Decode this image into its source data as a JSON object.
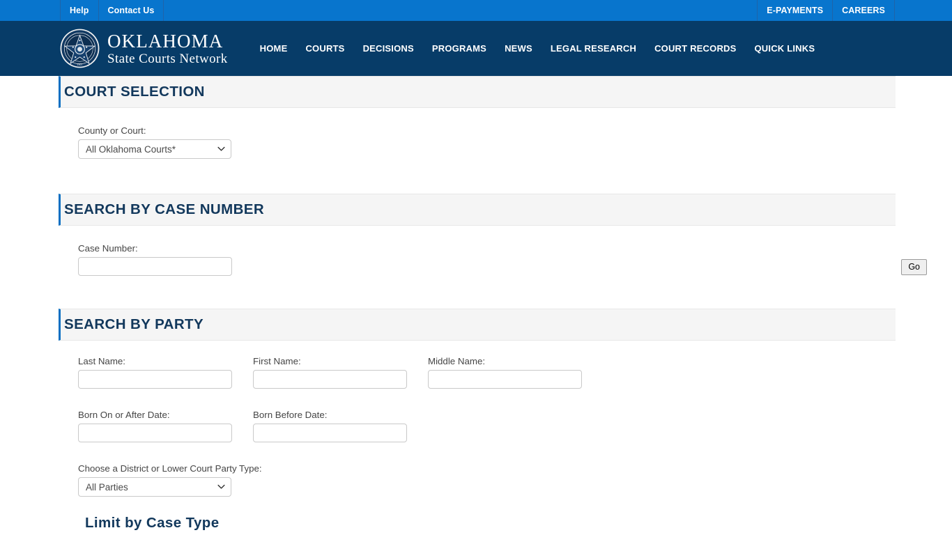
{
  "utility_bar": {
    "left_links": [
      {
        "label": "Help",
        "name": "help"
      },
      {
        "label": "Contact Us",
        "name": "contact-us"
      }
    ],
    "right_links": [
      {
        "label": "E-PAYMENTS",
        "name": "e-payments"
      },
      {
        "label": "CAREERS",
        "name": "careers"
      }
    ]
  },
  "brand": {
    "seal_icon": "oklahoma-state-seal-icon",
    "title": "OKLAHOMA",
    "subtitle": "State Courts Network"
  },
  "nav": {
    "items": [
      {
        "label": "HOME",
        "name": "home"
      },
      {
        "label": "COURTS",
        "name": "courts"
      },
      {
        "label": "DECISIONS",
        "name": "decisions"
      },
      {
        "label": "PROGRAMS",
        "name": "programs"
      },
      {
        "label": "NEWS",
        "name": "news"
      },
      {
        "label": "LEGAL RESEARCH",
        "name": "legal-research"
      },
      {
        "label": "COURT RECORDS",
        "name": "court-records"
      },
      {
        "label": "QUICK LINKS",
        "name": "quick-links"
      }
    ]
  },
  "court_selection": {
    "heading": "COURT SELECTION",
    "county_label": "County or Court:",
    "county_value": "All Oklahoma Courts*",
    "county_options": [
      "All Oklahoma Courts*"
    ]
  },
  "case_number": {
    "heading": "SEARCH BY CASE NUMBER",
    "case_label": "Case Number:",
    "case_value": "",
    "case_placeholder": "",
    "go_label": "Go"
  },
  "party": {
    "heading": "SEARCH BY PARTY",
    "last_name_label": "Last Name:",
    "last_name_value": "",
    "first_name_label": "First Name:",
    "first_name_value": "",
    "middle_name_label": "Middle Name:",
    "middle_name_value": "",
    "born_on_or_after_label": "Born On or After Date:",
    "born_on_or_after_value": "",
    "born_before_label": "Born Before Date:",
    "born_before_value": "",
    "party_type_label": "Choose a District or Lower Court Party Type:",
    "party_type_value": "All Parties",
    "party_type_options": [
      "All Parties"
    ]
  },
  "case_type": {
    "heading": "Limit by Case Type"
  },
  "colors": {
    "utility_blue": "#0875cd",
    "header_navy": "#073c68",
    "heading_navy": "#12385c",
    "accent_blue": "#0a6fc2",
    "section_bg": "#f5f5f5"
  }
}
